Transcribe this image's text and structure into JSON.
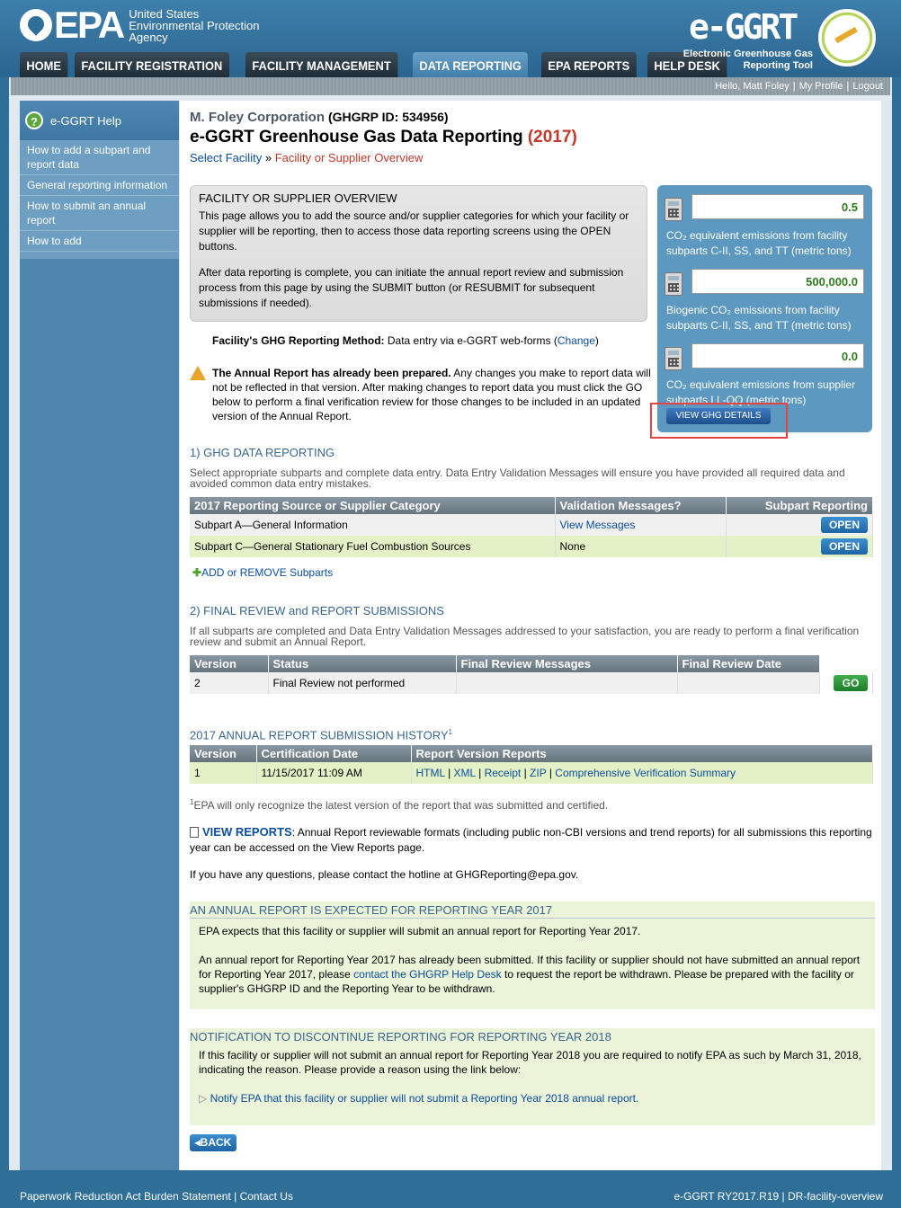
{
  "header": {
    "epa_text": "EPA",
    "agency_line1": "United States",
    "agency_line2": "Environmental Protection",
    "agency_line3": "Agency",
    "brand_title": "e-GGRT",
    "brand_sub1": "Electronic Greenhouse Gas",
    "brand_sub2": "Reporting Tool",
    "tabs": [
      "HOME",
      "FACILITY REGISTRATION",
      "FACILITY MANAGEMENT",
      "DATA REPORTING",
      "EPA REPORTS",
      "HELP DESK"
    ],
    "active_tab": "DATA REPORTING"
  },
  "topbar": {
    "greeting": "Hello, Matt Foley",
    "profile": "My Profile",
    "logout": "Logout"
  },
  "sidebar": {
    "help_title": "e-GGRT Help",
    "items": [
      "How to add a subpart and report data",
      "General reporting information",
      "How to submit an annual report",
      "How to add"
    ]
  },
  "page": {
    "company": "M. Foley Corporation",
    "ghgrp_id": "(GHGRP ID: 534956)",
    "title": "e-GGRT Greenhouse Gas Data Reporting",
    "year": "(2017)",
    "crumb_link": "Select Facility",
    "crumb_sep": "»",
    "crumb_current": "Facility or Supplier Overview"
  },
  "overview": {
    "heading": "FACILITY OR SUPPLIER OVERVIEW",
    "para1": "This page allows you to add the source and/or supplier categories for which your facility or supplier will be reporting, then to access those data reporting screens using the OPEN buttons.",
    "para2": "After data reporting is complete, you can initiate the annual report review and submission process from this page by using the SUBMIT button (or RESUBMIT for subsequent submissions if needed)."
  },
  "emissions": {
    "v1": "0.5",
    "l1": "CO₂ equivalent emissions from facility subparts C-II, SS, and TT (metric tons)",
    "v2": "500,000.0",
    "l2": "Biogenic CO₂ emissions from facility subparts C-II, SS, and TT (metric tons)",
    "v3": "0.0",
    "l3": "CO₂ equivalent emissions from supplier subparts LL-QQ (metric tons)",
    "button": "VIEW GHG DETAILS"
  },
  "method": {
    "label": "Facility's GHG Reporting Method:",
    "value": "Data entry via e-GGRT web-forms",
    "change": "Change"
  },
  "warning": {
    "bold": "The Annual Report has already been prepared.",
    "text": "Any changes you make to report data will not be reflected in that version. After making changes to report data you must click the GO below to perform a final verification review for those changes to be included in an updated version of the Annual Report."
  },
  "ghg": {
    "heading": "1) GHG DATA REPORTING",
    "note": "Select appropriate subparts and complete data entry. Data Entry Validation Messages will ensure you have provided all required data and avoided common data entry mistakes.",
    "columns": [
      "2017 Reporting Source or Supplier Category",
      "Validation Messages?",
      "Subpart Reporting"
    ],
    "rows": [
      {
        "category": "Subpart A—General Information",
        "messages": "View Messages",
        "action": "OPEN"
      },
      {
        "category": "Subpart C—General Stationary Fuel Combustion Sources",
        "messages": "None",
        "action": "OPEN"
      }
    ],
    "add_link": "ADD or REMOVE Subparts"
  },
  "final": {
    "heading": "2) FINAL REVIEW and REPORT SUBMISSIONS",
    "note": "If all subparts are completed and Data Entry Validation Messages addressed to your satisfaction, you are ready to perform a final verification review and submit an Annual Report.",
    "columns": [
      "Version",
      "Status",
      "Final Review Messages",
      "Final Review Date"
    ],
    "row": {
      "version": "2",
      "status": "Final Review not performed",
      "messages": "",
      "date": "",
      "action": "GO"
    }
  },
  "history": {
    "heading": "2017 ANNUAL REPORT SUBMISSION HISTORY",
    "sup": "1",
    "columns": [
      "Version",
      "Certification Date",
      "Report Version Reports"
    ],
    "row": {
      "version": "1",
      "date": "11/15/2017 11:09 AM",
      "html": "HTML",
      "xml": "XML",
      "receipt": "Receipt",
      "zip": "ZIP",
      "summary": "Comprehensive Verification Summary"
    },
    "footnote_sup": "1",
    "footnote": "EPA will only recognize the latest version of the report that was submitted and certified."
  },
  "reports": {
    "link": "VIEW REPORTS",
    "text": ": Annual Report reviewable formats (including public non-CBI versions and trend reports) for all submissions this reporting year can be accessed on the View Reports page."
  },
  "hotline": "If you have any questions, please contact the hotline at GHGReporting@epa.gov.",
  "expected": {
    "heading": "AN ANNUAL REPORT IS EXPECTED FOR REPORTING YEAR 2017",
    "p1": "EPA expects that this facility or supplier will submit an annual report for Reporting Year 2017.",
    "p2a": "An annual report for Reporting Year 2017 has already been submitted. If this facility or supplier should not have submitted an annual report for Reporting Year 2017, please",
    "p2link": "contact the GHGRP Help Desk",
    "p2b": "to request the report be withdrawn. Please be prepared with the facility or supplier's GHGRP ID and the Reporting Year to be withdrawn."
  },
  "discontinue": {
    "heading": "NOTIFICATION TO DISCONTINUE REPORTING FOR REPORTING YEAR 2018",
    "text": "If this facility or supplier will not submit an annual report for Reporting Year 2018 you are required to notify EPA as such by March 31, 2018, indicating the reason. Please provide a reason using the link below:",
    "link": "Notify EPA that this facility or supplier will not submit a Reporting Year 2018 annual report."
  },
  "back_button": "BACK",
  "footer": {
    "left1": "Paperwork Reduction Act Burden Statement",
    "left2": "Contact Us",
    "right1": "e-GGRT RY2017.R19",
    "right2": "DR-facility-overview"
  }
}
